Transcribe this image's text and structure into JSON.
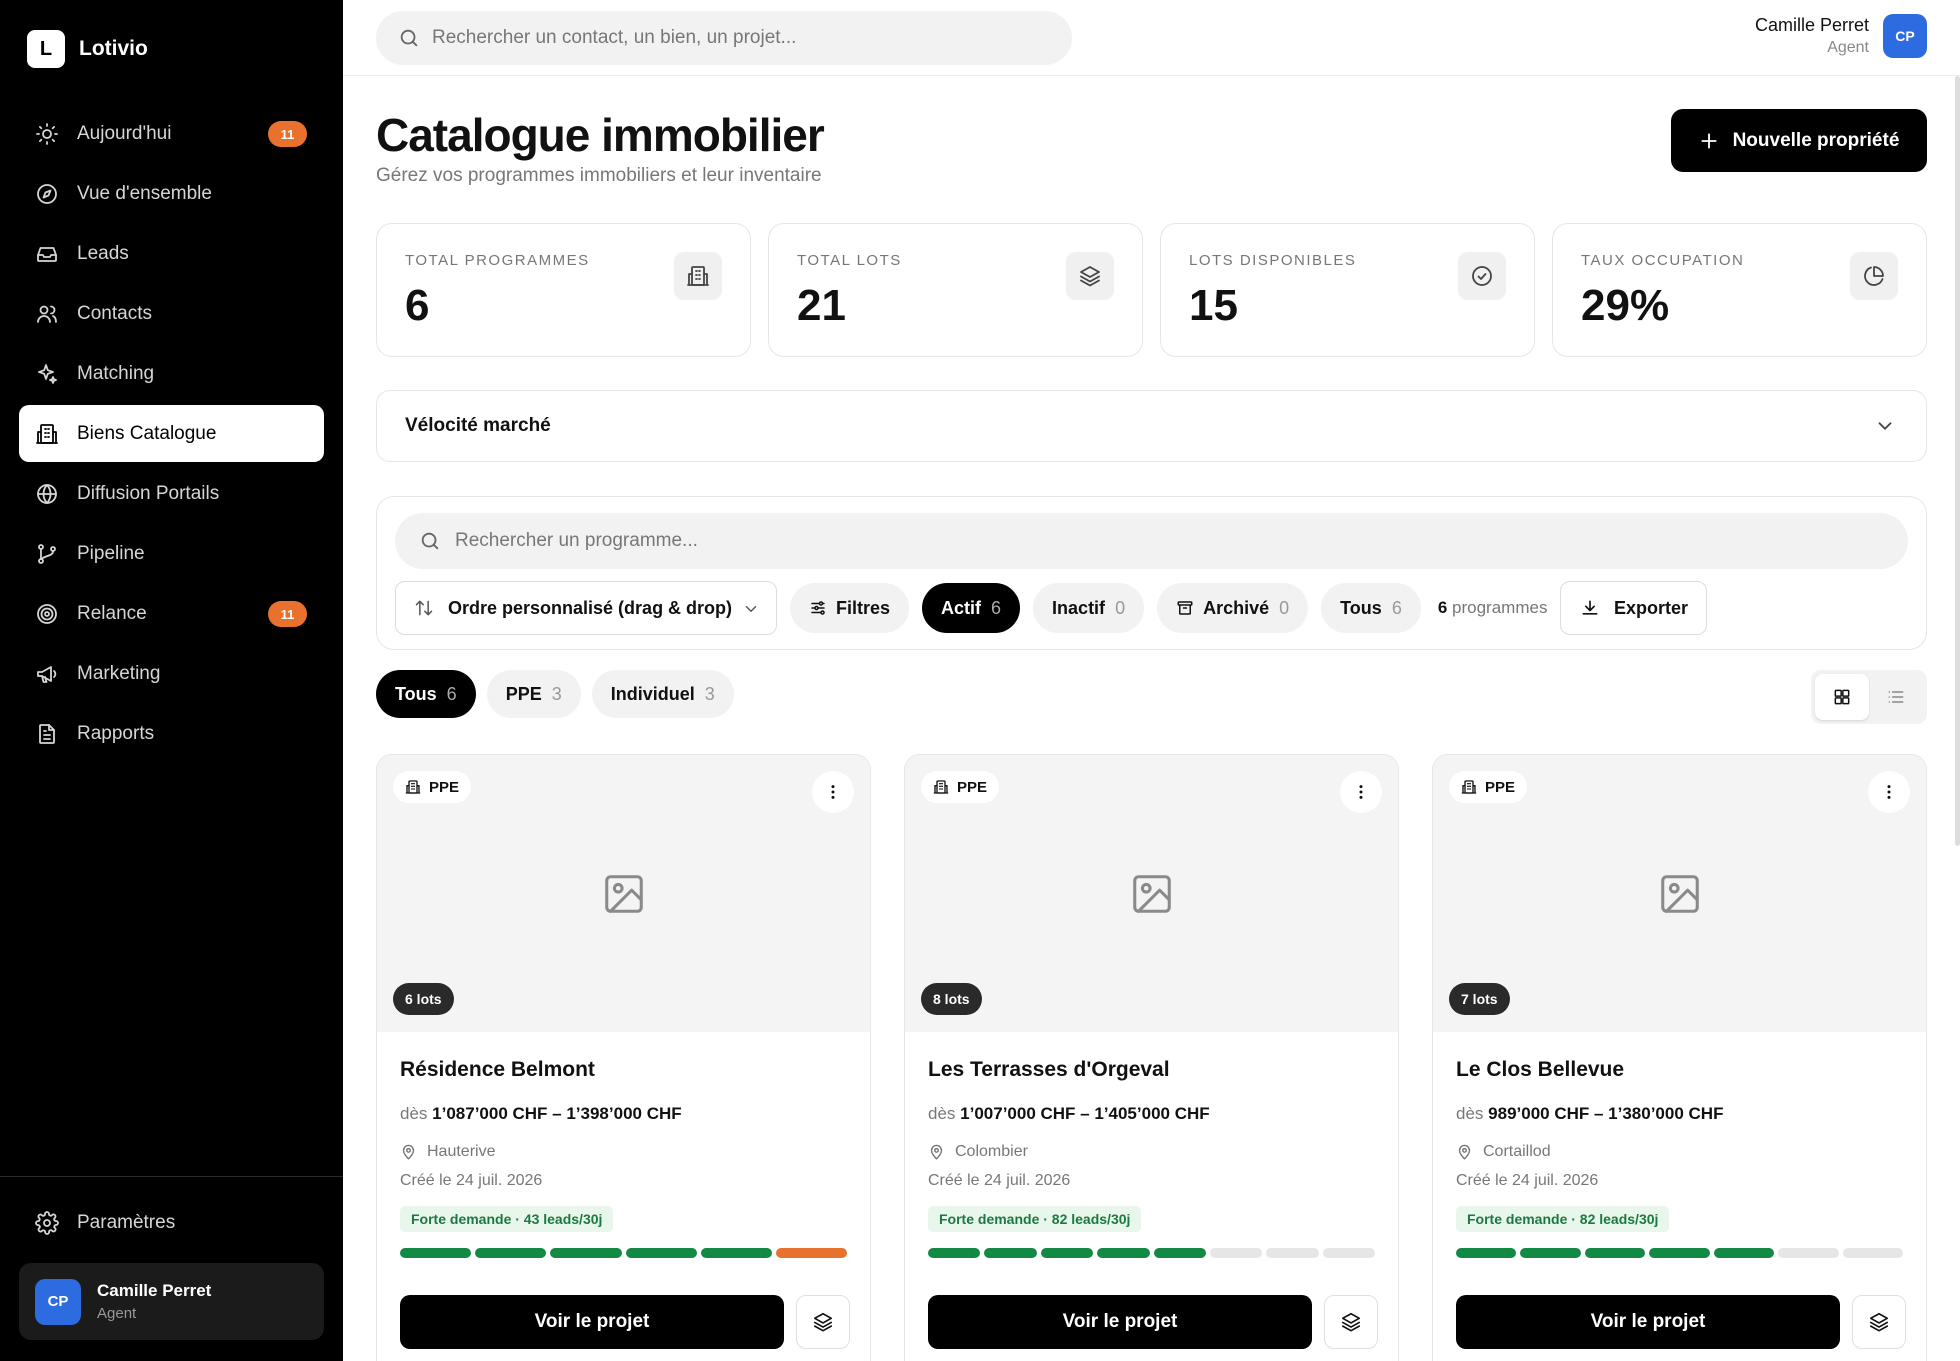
{
  "app": {
    "name": "Lotivio",
    "logo_letter": "L"
  },
  "sidebar": {
    "items": [
      {
        "label": "Aujourd'hui",
        "icon": "sun-icon",
        "badge": "11"
      },
      {
        "label": "Vue d'ensemble",
        "icon": "compass-icon"
      },
      {
        "label": "Leads",
        "icon": "inbox-icon"
      },
      {
        "label": "Contacts",
        "icon": "users-icon"
      },
      {
        "label": "Matching",
        "icon": "sparkles-icon"
      },
      {
        "label": "Biens Catalogue",
        "icon": "building-icon",
        "active": true
      },
      {
        "label": "Diffusion Portails",
        "icon": "globe-icon"
      },
      {
        "label": "Pipeline",
        "icon": "git-branch-icon"
      },
      {
        "label": "Relance",
        "icon": "target-icon",
        "badge": "11"
      },
      {
        "label": "Marketing",
        "icon": "megaphone-icon"
      },
      {
        "label": "Rapports",
        "icon": "file-text-icon"
      }
    ],
    "settings_label": "Paramètres",
    "user": {
      "initials": "CP",
      "name": "Camille Perret",
      "role": "Agent"
    }
  },
  "topbar": {
    "search_placeholder": "Rechercher un contact, un bien, un projet...",
    "user": {
      "initials": "CP",
      "name": "Camille Perret",
      "role": "Agent"
    }
  },
  "header": {
    "title": "Catalogue immobilier",
    "subtitle": "Gérez vos programmes immobiliers et leur inventaire",
    "new_button": "Nouvelle propriété"
  },
  "stats": [
    {
      "label": "TOTAL PROGRAMMES",
      "value": "6",
      "icon": "building-icon"
    },
    {
      "label": "TOTAL LOTS",
      "value": "21",
      "icon": "layers-icon"
    },
    {
      "label": "LOTS DISPONIBLES",
      "value": "15",
      "icon": "check-circle-icon"
    },
    {
      "label": "TAUX OCCUPATION",
      "value": "29%",
      "icon": "pie-chart-icon"
    }
  ],
  "velocity": {
    "label": "Vélocité marché"
  },
  "filters": {
    "search_placeholder": "Rechercher un programme...",
    "sort_label": "Ordre personnalisé (drag & drop)",
    "filters_label": "Filtres",
    "status": [
      {
        "label": "Actif",
        "count": "6",
        "active": true
      },
      {
        "label": "Inactif",
        "count": "0"
      },
      {
        "label": "Archivé",
        "count": "0"
      },
      {
        "label": "Tous",
        "count": "6"
      }
    ],
    "program_count": "6",
    "program_count_label": "programmes",
    "export_label": "Exporter"
  },
  "type_tabs": [
    {
      "label": "Tous",
      "count": "6",
      "active": true
    },
    {
      "label": "PPE",
      "count": "3"
    },
    {
      "label": "Individuel",
      "count": "3"
    }
  ],
  "view": {
    "selected": "grid"
  },
  "colors": {
    "accent": "#000000",
    "badge": "#e8712d",
    "demand_green": "#1b7a3f",
    "bar_green": "#128a43",
    "bar_orange": "#e8712d",
    "avatar_blue": "#2d6be0"
  },
  "cards": [
    {
      "type": "PPE",
      "lots": "6 lots",
      "name": "Résidence Belmont",
      "price_prefix": "dès",
      "price": "1’087’000 CHF – 1’398’000 CHF",
      "location": "Hauterive",
      "created": "Créé le 24 juil. 2026",
      "demand": "Forte demande · 43 leads/30j",
      "bars": [
        "green",
        "green",
        "green",
        "green",
        "green",
        "orange"
      ],
      "cta": "Voir le projet"
    },
    {
      "type": "PPE",
      "lots": "8 lots",
      "name": "Les Terrasses d'Orgeval",
      "price_prefix": "dès",
      "price": "1’007’000 CHF – 1’405’000 CHF",
      "location": "Colombier",
      "created": "Créé le 24 juil. 2026",
      "demand": "Forte demande · 82 leads/30j",
      "bars": [
        "green",
        "green",
        "green",
        "green",
        "green",
        "gray",
        "gray",
        "gray"
      ],
      "cta": "Voir le projet"
    },
    {
      "type": "PPE",
      "lots": "7 lots",
      "name": "Le Clos Bellevue",
      "price_prefix": "dès",
      "price": "989’000 CHF – 1’380’000 CHF",
      "location": "Cortaillod",
      "created": "Créé le 24 juil. 2026",
      "demand": "Forte demande · 82 leads/30j",
      "bars": [
        "green",
        "green",
        "green",
        "green",
        "green",
        "gray",
        "gray"
      ],
      "cta": "Voir le projet"
    }
  ]
}
